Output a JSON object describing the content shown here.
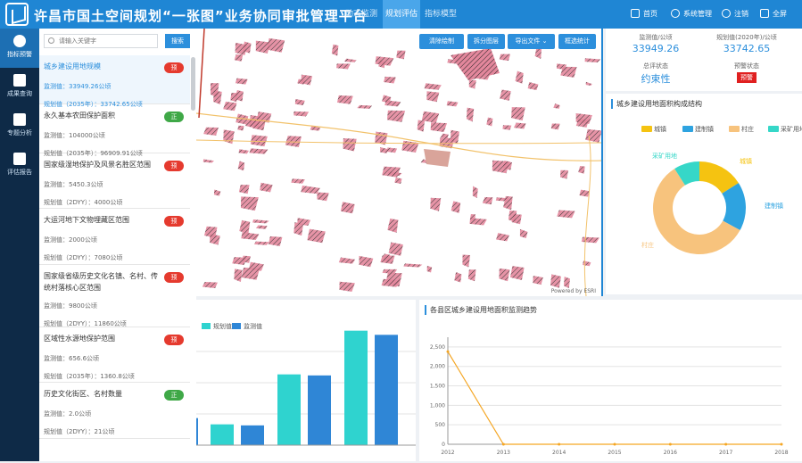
{
  "header": {
    "title": "许昌市国土空间规划“一张图”业务协同审批管理平台",
    "nav": [
      "动态监测",
      "规划评估",
      "指标模型"
    ],
    "active_nav": 1,
    "tools": {
      "home": "首页",
      "user": "系统管理",
      "logout": "注销",
      "fullscreen": "全屏"
    }
  },
  "sidenav": [
    {
      "label": "指标预警",
      "icon": "warning-icon"
    },
    {
      "label": "成果查询",
      "icon": "query-icon"
    },
    {
      "label": "专题分析",
      "icon": "analysis-icon"
    },
    {
      "label": "评估报告",
      "icon": "report-icon"
    }
  ],
  "search": {
    "placeholder": "请输入关键字",
    "button": "搜索"
  },
  "items": [
    {
      "title": "城乡建设用地规模",
      "badge": "预",
      "badge_color": "#e53a2e",
      "line1": "监测值：33949.26公顷",
      "line2": "规划值（2035年）：33742.65公顷"
    },
    {
      "title": "永久基本农田保护面积",
      "badge": "正",
      "badge_color": "#3fa847",
      "line1": "监测值：104000公顷",
      "line2": "规划值（2035年）：96909.91公顷"
    },
    {
      "title": "国家级湿地保护及风景名胜区范围",
      "badge": "预",
      "badge_color": "#e53a2e",
      "line1": "监测值：5450.3公顷",
      "line2": "规划值（2DYY）：4000公顷"
    },
    {
      "title": "大运河地下文物埋藏区范围",
      "badge": "预",
      "badge_color": "#e53a2e",
      "line1": "监测值：2000公顷",
      "line2": "规划值（2DYY）：7080公顷"
    },
    {
      "title": "国家级省级历史文化名镇、名村、传统村落核心区范围",
      "badge": "预",
      "badge_color": "#e53a2e",
      "line1": "监测值：9800公顷",
      "line2": "规划值（2DYY）：11860公顷"
    },
    {
      "title": "区域性水源地保护范围",
      "badge": "预",
      "badge_color": "#e53a2e",
      "line1": "监测值：656.6公顷",
      "line2": "规划值（2035年）：1360.8公顷"
    },
    {
      "title": "历史文化街区、名村数量",
      "badge": "正",
      "badge_color": "#3fa847",
      "line1": "监测值：2.0公顷",
      "line2": "规划值（2DYY）：21公顷"
    }
  ],
  "map": {
    "tools": [
      "清除绘制",
      "拆分图层",
      "导出文件",
      "框选统计"
    ],
    "attribution": "Powered by ESRI"
  },
  "stats": {
    "monitor_label": "监测值/公顷",
    "monitor_value": "33949.26",
    "plan_label": "规划值(2020年)/公顷",
    "plan_value": "33742.65",
    "status_label": "总评状态",
    "status_value": "约束性",
    "warn_label": "预警状态",
    "warn_value": "预警"
  },
  "donut": {
    "title": "城乡建设用地面积构成结构",
    "legend": [
      "城镇",
      "建制镇",
      "村庄",
      "采矿用地"
    ],
    "colors": [
      "#f5c311",
      "#2ea3e0",
      "#f7c37d",
      "#36d7c8"
    ],
    "values": [
      16,
      17,
      58,
      9
    ],
    "slice_labels": [
      "城镇",
      "建制镇",
      "村庄",
      "采矿用地"
    ]
  },
  "bar_chart": {
    "legend": [
      "规划值",
      "监测值"
    ],
    "colors": [
      "#2fd3cf",
      "#2f86d6"
    ],
    "values": [
      [
        20,
        19
      ],
      [
        68,
        67
      ],
      [
        110,
        106
      ]
    ],
    "partial_first": 26,
    "ymax": 120
  },
  "line_chart": {
    "title": "各县区城乡建设用地面积监测趋势",
    "x": [
      "2012",
      "2013",
      "2014",
      "2015",
      "2016",
      "2017",
      "2018"
    ],
    "y_ticks": [
      "0",
      "500",
      "1,000",
      "1,500",
      "2,000",
      "2,500"
    ],
    "values": [
      2380,
      0,
      0,
      0,
      0,
      0,
      0
    ],
    "ymax": 2750,
    "color": "#f5a623"
  }
}
